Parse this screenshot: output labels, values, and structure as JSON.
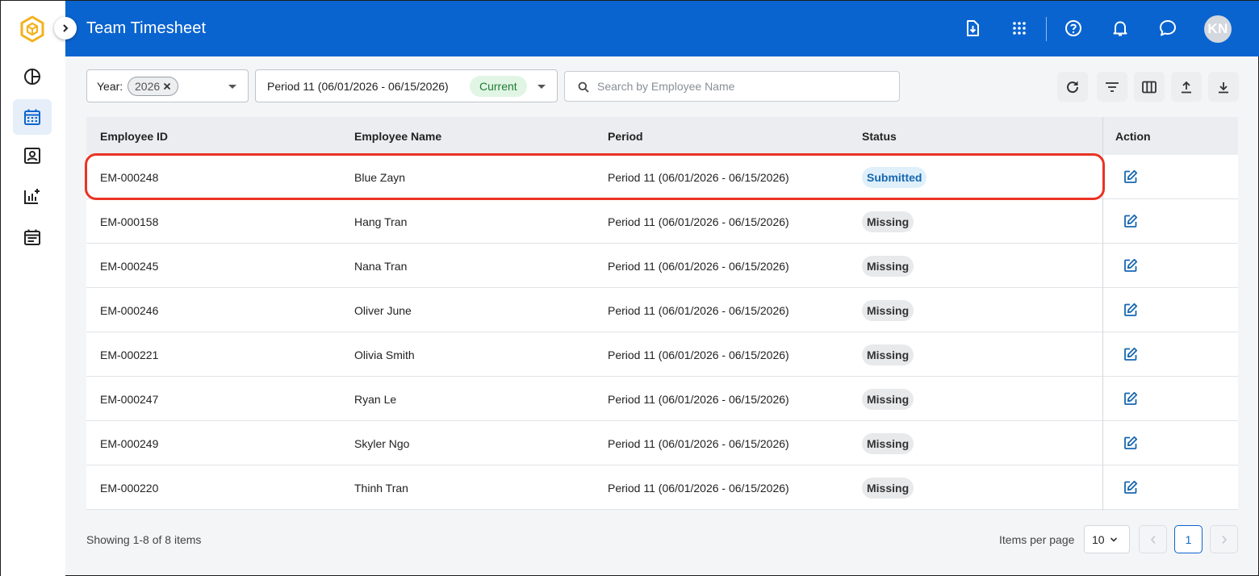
{
  "header": {
    "title": "Team Timesheet",
    "avatar_initials": "KN",
    "icons": [
      "download-doc-icon",
      "apps-grid-icon",
      "help-icon",
      "notification-bell-icon",
      "chat-icon"
    ]
  },
  "sidebar": {
    "items": [
      {
        "icon": "dashboard-icon",
        "active": false
      },
      {
        "icon": "calendar-icon",
        "active": true
      },
      {
        "icon": "contact-card-icon",
        "active": false
      },
      {
        "icon": "analytics-add-icon",
        "active": false
      },
      {
        "icon": "event-note-icon",
        "active": false
      }
    ]
  },
  "filters": {
    "year_label": "Year:",
    "year_value": "2026",
    "period_value": "Period 11 (06/01/2026 - 06/15/2026)",
    "period_badge": "Current",
    "search_placeholder": "Search by Employee Name"
  },
  "table": {
    "columns": {
      "id": "Employee ID",
      "name": "Employee Name",
      "period": "Period",
      "status": "Status",
      "action": "Action"
    },
    "rows": [
      {
        "id": "EM-000248",
        "name": "Blue Zayn",
        "period": "Period 11 (06/01/2026 - 06/15/2026)",
        "status": "Submitted"
      },
      {
        "id": "EM-000158",
        "name": "Hang Tran",
        "period": "Period 11 (06/01/2026 - 06/15/2026)",
        "status": "Missing"
      },
      {
        "id": "EM-000245",
        "name": "Nana Tran",
        "period": "Period 11 (06/01/2026 - 06/15/2026)",
        "status": "Missing"
      },
      {
        "id": "EM-000246",
        "name": "Oliver June",
        "period": "Period 11 (06/01/2026 - 06/15/2026)",
        "status": "Missing"
      },
      {
        "id": "EM-000221",
        "name": "Olivia Smith",
        "period": "Period 11 (06/01/2026 - 06/15/2026)",
        "status": "Missing"
      },
      {
        "id": "EM-000247",
        "name": "Ryan Le",
        "period": "Period 11 (06/01/2026 - 06/15/2026)",
        "status": "Missing"
      },
      {
        "id": "EM-000249",
        "name": "Skyler Ngo",
        "period": "Period 11 (06/01/2026 - 06/15/2026)",
        "status": "Missing"
      },
      {
        "id": "EM-000220",
        "name": "Thinh Tran",
        "period": "Period 11 (06/01/2026 - 06/15/2026)",
        "status": "Missing"
      }
    ]
  },
  "footer": {
    "showing": "Showing 1-8 of 8 items",
    "items_per_page_label": "Items per page",
    "items_per_page_value": "10",
    "current_page": "1"
  },
  "colors": {
    "header_bg": "#0a64d0",
    "highlight": "#ea3323",
    "submitted_text": "#1767b0",
    "current_badge_text": "#1e7b34"
  }
}
